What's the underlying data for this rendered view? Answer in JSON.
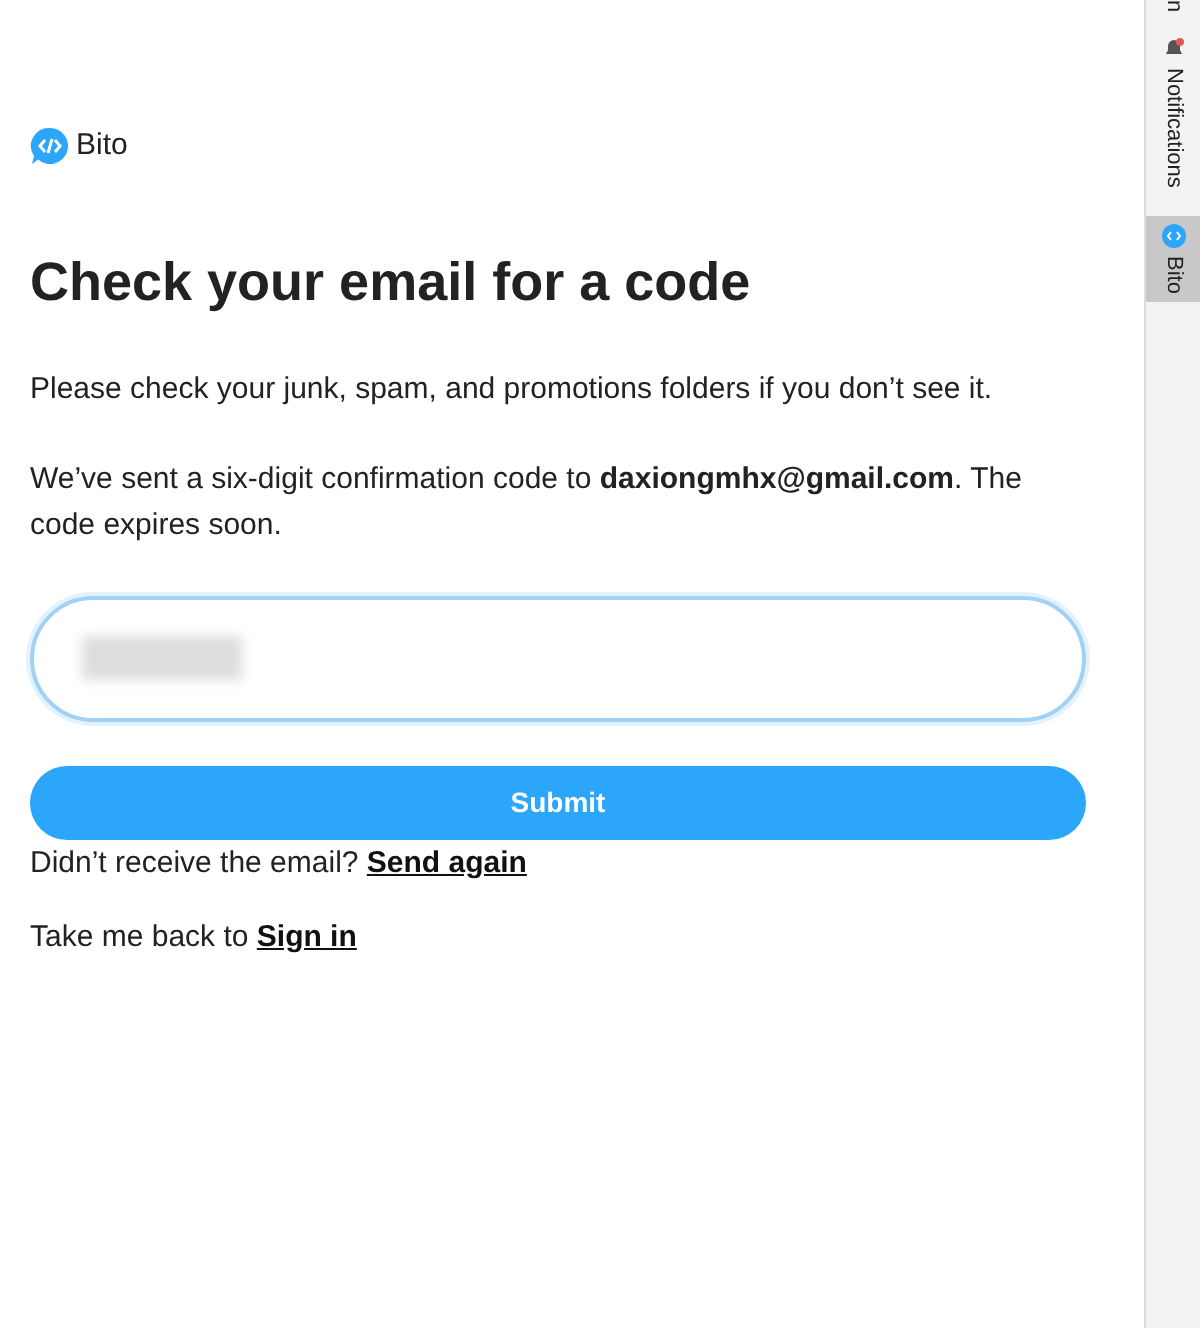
{
  "brand": {
    "name": "Bito"
  },
  "heading": "Check your email for a code",
  "notice": "Please check your junk, spam, and promotions folders if you don’t see it.",
  "sent_message": "We’ve sent a six-digit confirmation code to **daxiongmhx@gmail.com**. The code expires soon.",
  "code_field": {
    "redacted": true
  },
  "submit_button": "Submit",
  "resend": {
    "text": "Didn’t receive the email?",
    "link": "Send again"
  },
  "back": {
    "text": "Take me back to",
    "link": "Sign in"
  },
  "side_tabs": [
    {
      "label": "n",
      "kind": "cut",
      "selected": false
    },
    {
      "label": "Notifications",
      "kind": "bell",
      "selected": false
    },
    {
      "label": "Bito",
      "kind": "bito",
      "selected": true
    }
  ]
}
